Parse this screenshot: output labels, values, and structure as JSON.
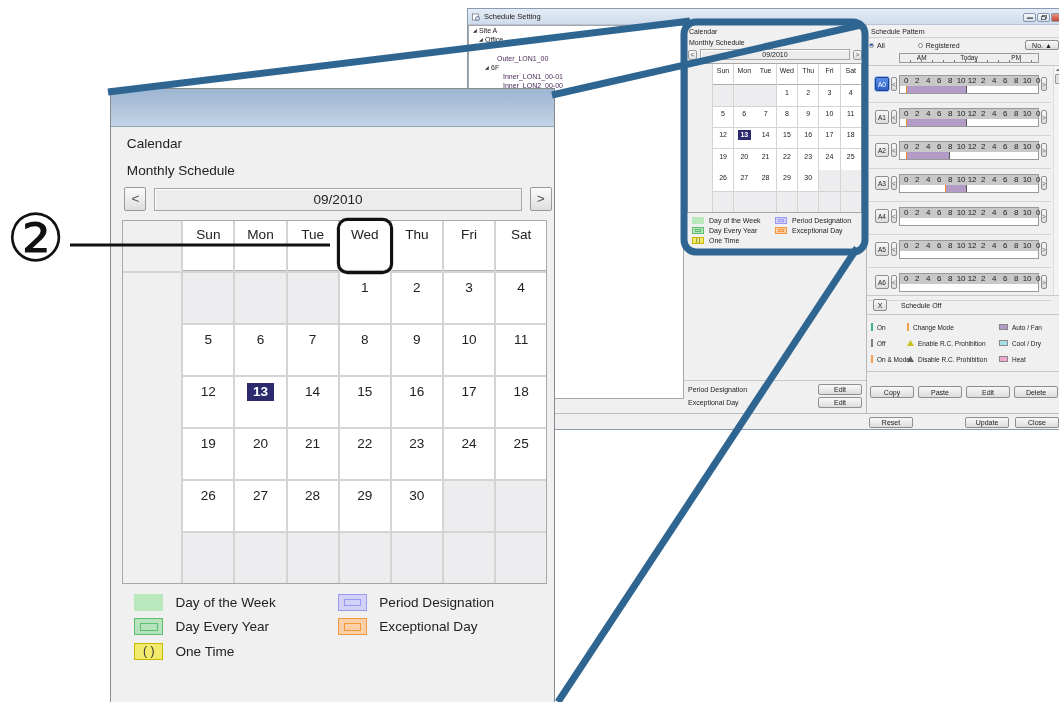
{
  "window": {
    "title": "Schedule Setting"
  },
  "tree": [
    {
      "label": "Site A",
      "expanded": true,
      "children": [
        {
          "label": "Office",
          "expanded": true,
          "children": [
            {
              "label": "Outer_LON1_00"
            },
            {
              "label": "6F",
              "expanded": true,
              "children": [
                {
                  "label": "Inner_LON1_00-01"
                },
                {
                  "label": "Inner_LON2_00-00"
                }
              ]
            }
          ]
        }
      ]
    }
  ],
  "calendar_small": {
    "title": "Calendar",
    "subtitle": "Monthly Schedule",
    "prev": "<",
    "month": "09/2010",
    "next": ">",
    "weekdays": [
      {
        "label": "Sun"
      },
      {
        "label": "Mon"
      },
      {
        "label": "Tue"
      },
      {
        "label": "Wed"
      },
      {
        "label": "Thu"
      },
      {
        "label": "Fri"
      },
      {
        "label": "Sat"
      }
    ],
    "weeks": [
      [
        {
          "in_month": false,
          "selected": false
        },
        {
          "in_month": false,
          "selected": false
        },
        {
          "in_month": false,
          "selected": false
        },
        {
          "day": "1",
          "in_month": true,
          "selected": false
        },
        {
          "day": "2",
          "in_month": true,
          "selected": false
        },
        {
          "day": "3",
          "in_month": true,
          "selected": false
        },
        {
          "day": "4",
          "in_month": true,
          "selected": false
        }
      ],
      [
        {
          "day": "5",
          "in_month": true,
          "selected": false
        },
        {
          "day": "6",
          "in_month": true,
          "selected": false
        },
        {
          "day": "7",
          "in_month": true,
          "selected": false
        },
        {
          "day": "8",
          "in_month": true,
          "selected": false
        },
        {
          "day": "9",
          "in_month": true,
          "selected": false
        },
        {
          "day": "10",
          "in_month": true,
          "selected": false
        },
        {
          "day": "11",
          "in_month": true,
          "selected": false
        }
      ],
      [
        {
          "day": "12",
          "in_month": true,
          "selected": false
        },
        {
          "day": "13",
          "in_month": true,
          "selected": true
        },
        {
          "day": "14",
          "in_month": true,
          "selected": false
        },
        {
          "day": "15",
          "in_month": true,
          "selected": false
        },
        {
          "day": "16",
          "in_month": true,
          "selected": false
        },
        {
          "day": "17",
          "in_month": true,
          "selected": false
        },
        {
          "day": "18",
          "in_month": true,
          "selected": false
        }
      ],
      [
        {
          "day": "19",
          "in_month": true,
          "selected": false
        },
        {
          "day": "20",
          "in_month": true,
          "selected": false
        },
        {
          "day": "21",
          "in_month": true,
          "selected": false
        },
        {
          "day": "22",
          "in_month": true,
          "selected": false
        },
        {
          "day": "23",
          "in_month": true,
          "selected": false
        },
        {
          "day": "24",
          "in_month": true,
          "selected": false
        },
        {
          "day": "25",
          "in_month": true,
          "selected": false
        }
      ],
      [
        {
          "day": "26",
          "in_month": true,
          "selected": false
        },
        {
          "day": "27",
          "in_month": true,
          "selected": false
        },
        {
          "day": "28",
          "in_month": true,
          "selected": false
        },
        {
          "day": "29",
          "in_month": true,
          "selected": false
        },
        {
          "day": "30",
          "in_month": true,
          "selected": false
        },
        {
          "in_month": false,
          "selected": false
        },
        {
          "in_month": false,
          "selected": false
        }
      ],
      [
        {
          "in_month": false,
          "selected": false
        },
        {
          "in_month": false,
          "selected": false
        },
        {
          "in_month": false,
          "selected": false
        },
        {
          "in_month": false,
          "selected": false
        },
        {
          "in_month": false,
          "selected": false
        },
        {
          "in_month": false,
          "selected": false
        },
        {
          "in_month": false,
          "selected": false
        }
      ]
    ],
    "legend": [
      {
        "label": "Day of the Week",
        "kind": "fill",
        "color": "#b8e8bc"
      },
      {
        "label": "Period Designation",
        "kind": "outline",
        "color": "#9a9af0"
      },
      {
        "label": "Day Every Year",
        "kind": "outline",
        "color": "#5cc06c"
      },
      {
        "label": "Exceptional Day",
        "kind": "outline",
        "color": "#f5963c"
      },
      {
        "label": "One Time",
        "kind": "bracket",
        "color": "#f2ea6a",
        "symbol": "( )"
      }
    ]
  },
  "calendar_actions": [
    {
      "label": "Period Designation",
      "button": "Edit"
    },
    {
      "label": "Exceptional Day",
      "button": "Edit"
    }
  ],
  "schedule_pattern": {
    "title": "Schedule Pattern",
    "filters": [
      {
        "label": "All",
        "selected": true
      },
      {
        "label": "Registered",
        "selected": false
      }
    ],
    "sort_button": "No. ▲",
    "time_header": [
      "AM",
      "Today",
      "PM"
    ],
    "patterns": [
      {
        "label": "A0",
        "selected": true,
        "prev": "<",
        "next": ">",
        "ticks": [
          "0",
          "2",
          "4",
          "6",
          "8",
          "10",
          "12",
          "2",
          "4",
          "6",
          "8",
          "10",
          "0"
        ],
        "slots": [
          true,
          true,
          true,
          true,
          true,
          true,
          true,
          true,
          true,
          true,
          true,
          false,
          false,
          false,
          false,
          false,
          false,
          false,
          false,
          false,
          false,
          false,
          false,
          false
        ]
      },
      {
        "label": "A1",
        "selected": false,
        "prev": "<",
        "next": ">",
        "ticks": [
          "0",
          "2",
          "4",
          "6",
          "8",
          "10",
          "12",
          "2",
          "4",
          "6",
          "8",
          "10",
          "0"
        ],
        "slots": [
          true,
          true,
          true,
          true,
          true,
          true,
          true,
          true,
          true,
          true,
          true,
          false,
          false,
          false,
          false,
          false,
          false,
          false,
          false,
          false,
          false,
          false,
          false,
          false
        ]
      },
      {
        "label": "A2",
        "selected": false,
        "prev": "<",
        "next": ">",
        "ticks": [
          "0",
          "2",
          "4",
          "6",
          "8",
          "10",
          "12",
          "2",
          "4",
          "6",
          "8",
          "10",
          "0"
        ],
        "slots": [
          true,
          true,
          true,
          true,
          true,
          true,
          true,
          true,
          false,
          false,
          false,
          false,
          false,
          false,
          false,
          false,
          false,
          false,
          false,
          false,
          false,
          false,
          false,
          false
        ]
      },
      {
        "label": "A3",
        "selected": false,
        "prev": "<",
        "next": ">",
        "ticks": [
          "0",
          "2",
          "4",
          "6",
          "8",
          "10",
          "12",
          "2",
          "4",
          "6",
          "8",
          "10",
          "0"
        ],
        "slots": [
          false,
          false,
          false,
          false,
          false,
          false,
          false,
          true,
          true,
          true,
          true,
          false,
          false,
          false,
          false,
          false,
          false,
          false,
          false,
          false,
          false,
          false,
          false,
          false
        ]
      },
      {
        "label": "A4",
        "selected": false,
        "prev": "<",
        "next": ">",
        "ticks": [
          "0",
          "2",
          "4",
          "6",
          "8",
          "10",
          "12",
          "2",
          "4",
          "6",
          "8",
          "10",
          "0"
        ]
      },
      {
        "label": "A5",
        "selected": false,
        "prev": "<",
        "next": ">",
        "ticks": [
          "0",
          "2",
          "4",
          "6",
          "8",
          "10",
          "12",
          "2",
          "4",
          "6",
          "8",
          "10",
          "0"
        ]
      },
      {
        "label": "A6",
        "selected": false,
        "prev": "<",
        "next": ">",
        "ticks": [
          "0",
          "2",
          "4",
          "6",
          "8",
          "10",
          "12",
          "2",
          "4",
          "6",
          "8",
          "10",
          "0"
        ]
      }
    ],
    "off_button": "X",
    "off_label": "Schedule Off",
    "legend": [
      {
        "label": "On",
        "kind": "line",
        "color": "#3cb48c"
      },
      {
        "label": "Change Mode",
        "kind": "dashed",
        "color": "#f5a050"
      },
      {
        "label": "Auto / Fan",
        "kind": "swatch",
        "color": "#b39bc8"
      },
      {
        "label": "Off",
        "kind": "line",
        "color": "#808080"
      },
      {
        "label": "Enable R.C. Prohibition",
        "kind": "triangle",
        "color": "#c8c020"
      },
      {
        "label": "Cool / Dry",
        "kind": "swatch",
        "color": "#a8e0e8"
      },
      {
        "label": "On & Mode",
        "kind": "line",
        "color": "#f5a050"
      },
      {
        "label": "Disable R.C. Prohibition",
        "kind": "triangle",
        "color": "#606060"
      },
      {
        "label": "Heat",
        "kind": "swatch",
        "color": "#f0a8d0"
      }
    ],
    "actions": [
      "Copy",
      "Paste",
      "Edit",
      "Delete"
    ]
  },
  "footer_buttons": [
    "Reset",
    "Update",
    "Close"
  ],
  "calendar_zoom": {
    "title": "Calendar",
    "subtitle": "Monthly Schedule",
    "prev": "<",
    "month": "09/2010",
    "next": ">",
    "weekdays": [
      {
        "label": "Sun",
        "highlighted": false
      },
      {
        "label": "Mon",
        "highlighted": false
      },
      {
        "label": "Tue",
        "highlighted": false
      },
      {
        "label": "Wed",
        "highlighted": true
      },
      {
        "label": "Thu",
        "highlighted": false
      },
      {
        "label": "Fri",
        "highlighted": false
      },
      {
        "label": "Sat",
        "highlighted": false
      }
    ],
    "weeks": [
      [
        {
          "in_month": false,
          "selected": false
        },
        {
          "in_month": false,
          "selected": false
        },
        {
          "in_month": false,
          "selected": false
        },
        {
          "day": "1",
          "in_month": true,
          "selected": false
        },
        {
          "day": "2",
          "in_month": true,
          "selected": false
        },
        {
          "day": "3",
          "in_month": true,
          "selected": false
        },
        {
          "day": "4",
          "in_month": true,
          "selected": false
        }
      ],
      [
        {
          "day": "5",
          "in_month": true,
          "selected": false
        },
        {
          "day": "6",
          "in_month": true,
          "selected": false
        },
        {
          "day": "7",
          "in_month": true,
          "selected": false
        },
        {
          "day": "8",
          "in_month": true,
          "selected": false
        },
        {
          "day": "9",
          "in_month": true,
          "selected": false
        },
        {
          "day": "10",
          "in_month": true,
          "selected": false
        },
        {
          "day": "11",
          "in_month": true,
          "selected": false
        }
      ],
      [
        {
          "day": "12",
          "in_month": true,
          "selected": false
        },
        {
          "day": "13",
          "in_month": true,
          "selected": true
        },
        {
          "day": "14",
          "in_month": true,
          "selected": false
        },
        {
          "day": "15",
          "in_month": true,
          "selected": false
        },
        {
          "day": "16",
          "in_month": true,
          "selected": false
        },
        {
          "day": "17",
          "in_month": true,
          "selected": false
        },
        {
          "day": "18",
          "in_month": true,
          "selected": false
        }
      ],
      [
        {
          "day": "19",
          "in_month": true,
          "selected": false
        },
        {
          "day": "20",
          "in_month": true,
          "selected": false
        },
        {
          "day": "21",
          "in_month": true,
          "selected": false
        },
        {
          "day": "22",
          "in_month": true,
          "selected": false
        },
        {
          "day": "23",
          "in_month": true,
          "selected": false
        },
        {
          "day": "24",
          "in_month": true,
          "selected": false
        },
        {
          "day": "25",
          "in_month": true,
          "selected": false
        }
      ],
      [
        {
          "day": "26",
          "in_month": true,
          "selected": false
        },
        {
          "day": "27",
          "in_month": true,
          "selected": false
        },
        {
          "day": "28",
          "in_month": true,
          "selected": false
        },
        {
          "day": "29",
          "in_month": true,
          "selected": false
        },
        {
          "day": "30",
          "in_month": true,
          "selected": false
        },
        {
          "in_month": false,
          "selected": false
        },
        {
          "in_month": false,
          "selected": false
        }
      ],
      [
        {
          "in_month": false,
          "selected": false
        },
        {
          "in_month": false,
          "selected": false
        },
        {
          "in_month": false,
          "selected": false
        },
        {
          "in_month": false,
          "selected": false
        },
        {
          "in_month": false,
          "selected": false
        },
        {
          "in_month": false,
          "selected": false
        },
        {
          "in_month": false,
          "selected": false
        }
      ]
    ],
    "legend": [
      {
        "label": "Day of the Week",
        "kind": "fill",
        "color": "#b8e8bc"
      },
      {
        "label": "Period Designation",
        "kind": "outline",
        "color": "#9a9af0"
      },
      {
        "label": "Day Every Year",
        "kind": "outline",
        "color": "#5cc06c"
      },
      {
        "label": "Exceptional Day",
        "kind": "outline",
        "color": "#f5963c"
      },
      {
        "label": "One Time",
        "kind": "bracket",
        "color": "#f2ea6a",
        "symbol": "( )"
      }
    ]
  },
  "callout": {
    "number": "②"
  }
}
